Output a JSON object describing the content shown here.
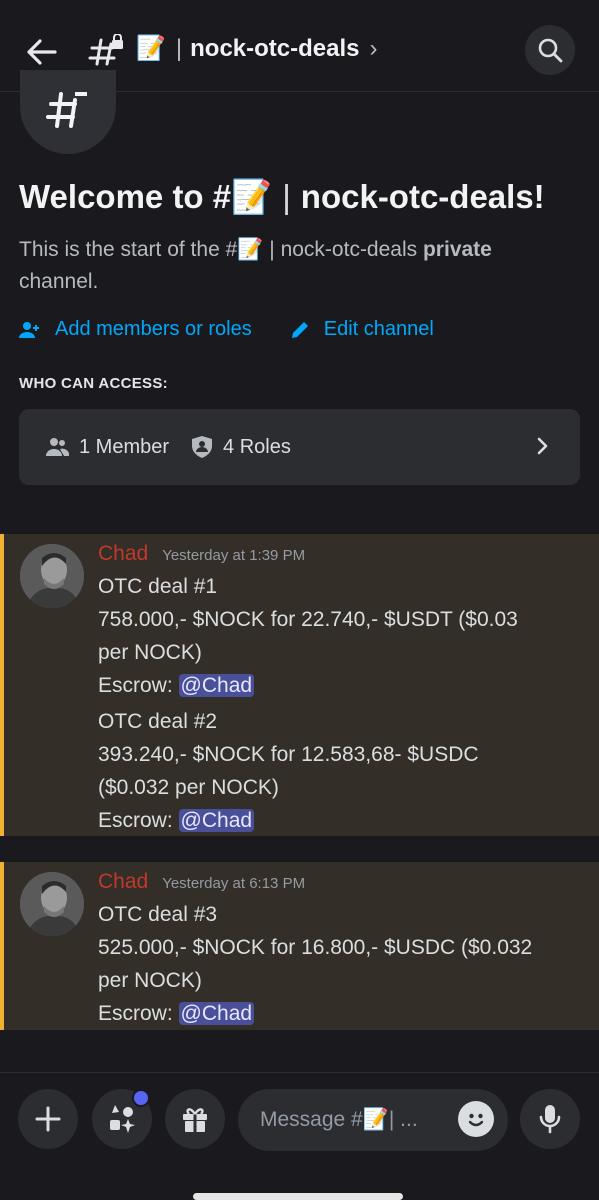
{
  "header": {
    "channel_emoji": "📝",
    "separator": "|",
    "channel_name": "nock-otc-deals",
    "chevron": "›"
  },
  "intro": {
    "icon_glyph": "#",
    "welcome_prefix": "Welcome to #",
    "welcome_emoji": "📝",
    "welcome_separator": "|",
    "welcome_name": "nock-otc-deals!",
    "start_prefix": "This is the start of the #",
    "start_emoji": "📝",
    "start_separator": "|",
    "start_name": "nock-otc-deals",
    "start_bold": "private",
    "start_suffix": "channel."
  },
  "actions": {
    "add_members": "Add members or roles",
    "edit_channel": "Edit channel"
  },
  "access": {
    "label": "WHO CAN ACCESS:",
    "members": "1 Member",
    "roles": "4 Roles"
  },
  "messages": [
    {
      "author": "Chad",
      "time": "Yesterday at 1:39 PM",
      "lines": [
        "OTC deal #1",
        "758.000,- $NOCK for 22.740,- $USDT ($0.03",
        "per NOCK)",
        "Escrow:",
        "OTC deal #2",
        "393.240,- $NOCK for 12.583,68- $USDC",
        "($0.032 per NOCK)",
        "Escrow:"
      ],
      "mention": "@Chad"
    },
    {
      "author": "Chad",
      "time": "Yesterday at 6:13 PM",
      "lines": [
        "OTC deal #3",
        "525.000,- $NOCK for 16.800,- $USDC ($0.032",
        "per NOCK)",
        "Escrow:"
      ],
      "mention": "@Chad"
    }
  ],
  "composer": {
    "placeholder_prefix": "Message #",
    "placeholder_emoji": "📝",
    "placeholder_suffix": " | ..."
  },
  "colors": {
    "background": "#1a1a1e",
    "link": "#00a8fc",
    "highlight_bg": "#332f28",
    "highlight_bar": "#f0b232",
    "author": "#c0392b",
    "mention_bg": "#4a4f9a",
    "notification": "#5865f2"
  },
  "icons": [
    "back-arrow-icon",
    "hashtag-lock-icon",
    "search-icon",
    "add-members-icon",
    "pencil-icon",
    "members-icon",
    "shield-icon",
    "chevron-right-icon",
    "plus-icon",
    "apps-icon",
    "gift-icon",
    "emoji-icon",
    "microphone-icon"
  ]
}
